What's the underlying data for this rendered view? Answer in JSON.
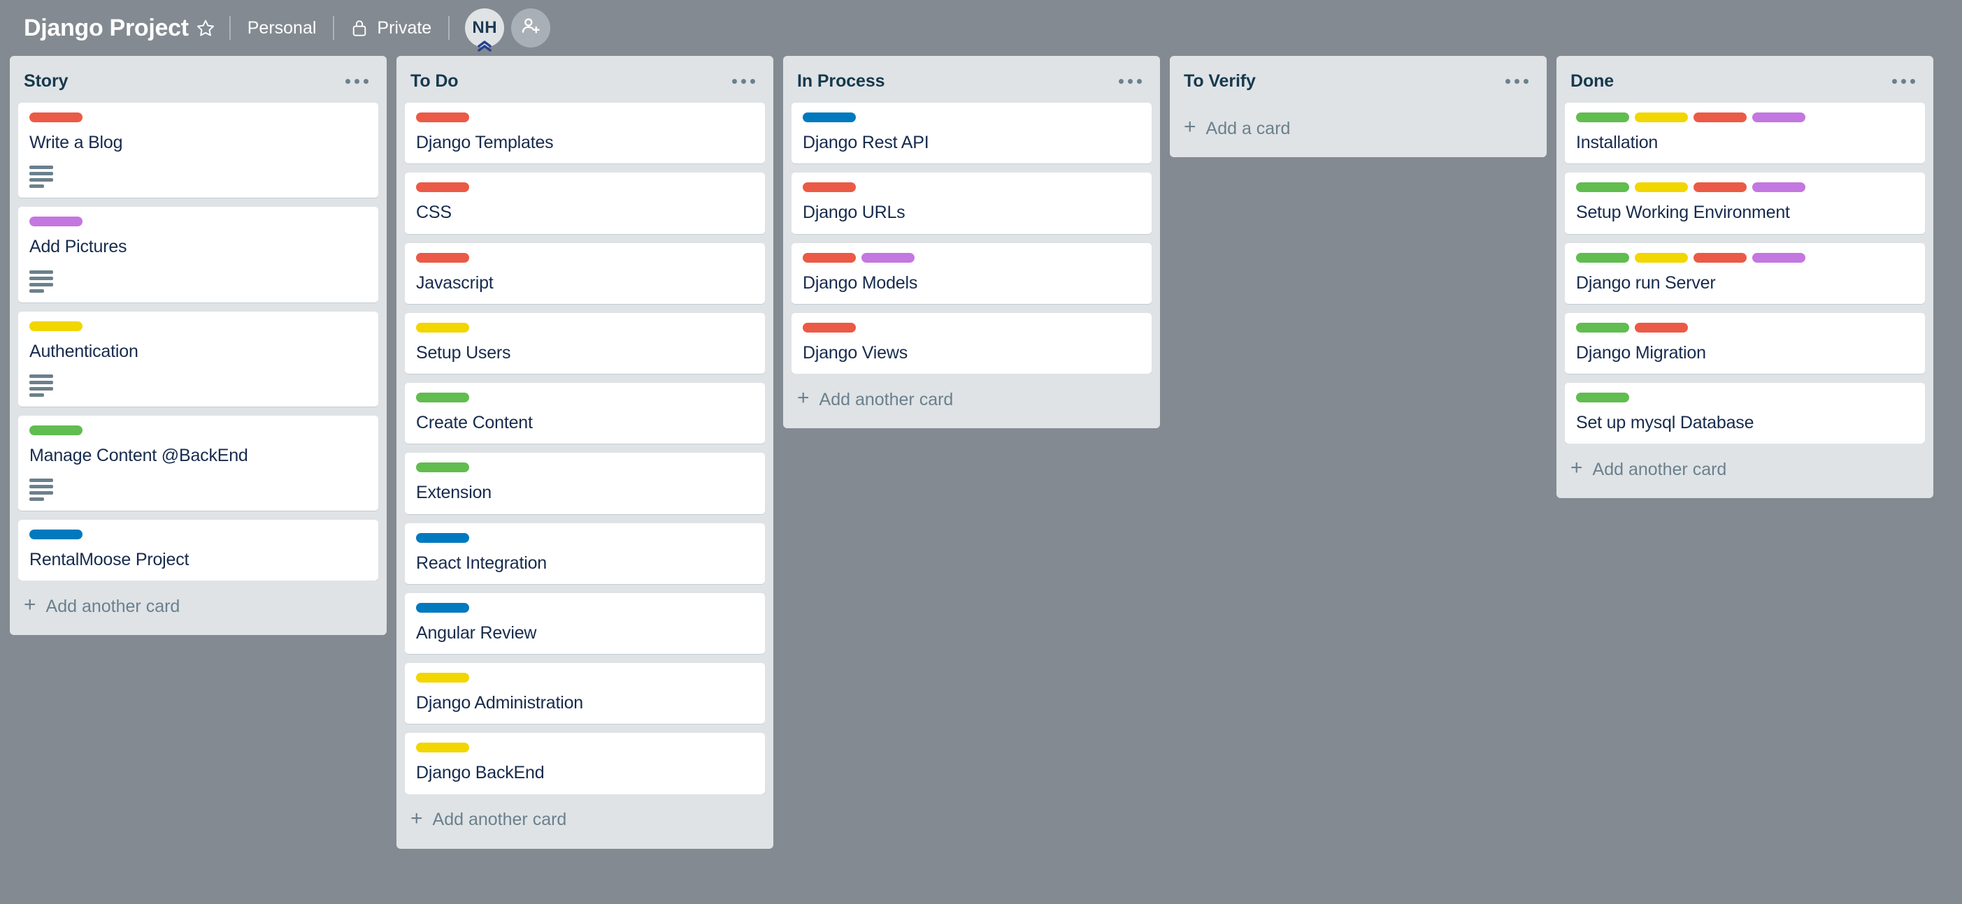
{
  "header": {
    "board_title": "Django Project",
    "star_icon": "star-icon",
    "workspace_label": "Personal",
    "visibility_label": "Private",
    "lock_icon": "lock-icon",
    "member_initials": "NH",
    "add_member_icon": "add-person-icon"
  },
  "label_colors": {
    "green": "#61bd4f",
    "yellow": "#f2d600",
    "red": "#eb5a46",
    "purple": "#c377e0",
    "blue": "#0079bf"
  },
  "lists": [
    {
      "title": "Story",
      "menu_icon": "list-menu-icon",
      "add_card_label": "Add another card",
      "cards": [
        {
          "title": "Write a Blog",
          "labels": [
            "red"
          ],
          "has_description": true
        },
        {
          "title": "Add Pictures",
          "labels": [
            "purple"
          ],
          "has_description": true
        },
        {
          "title": "Authentication",
          "labels": [
            "yellow"
          ],
          "has_description": true
        },
        {
          "title": "Manage Content @BackEnd",
          "labels": [
            "green"
          ],
          "has_description": true
        },
        {
          "title": "RentalMoose Project",
          "labels": [
            "blue"
          ],
          "has_description": false
        }
      ]
    },
    {
      "title": "To Do",
      "menu_icon": "list-menu-icon",
      "add_card_label": "Add another card",
      "cards": [
        {
          "title": "Django Templates",
          "labels": [
            "red"
          ],
          "has_description": false
        },
        {
          "title": "CSS",
          "labels": [
            "red"
          ],
          "has_description": false
        },
        {
          "title": "Javascript",
          "labels": [
            "red"
          ],
          "has_description": false
        },
        {
          "title": "Setup Users",
          "labels": [
            "yellow"
          ],
          "has_description": false
        },
        {
          "title": "Create Content",
          "labels": [
            "green"
          ],
          "has_description": false
        },
        {
          "title": "Extension",
          "labels": [
            "green"
          ],
          "has_description": false
        },
        {
          "title": "React Integration",
          "labels": [
            "blue"
          ],
          "has_description": false
        },
        {
          "title": "Angular Review",
          "labels": [
            "blue"
          ],
          "has_description": false
        },
        {
          "title": "Django Administration",
          "labels": [
            "yellow"
          ],
          "has_description": false
        },
        {
          "title": "Django BackEnd",
          "labels": [
            "yellow"
          ],
          "has_description": false
        }
      ]
    },
    {
      "title": "In Process",
      "menu_icon": "list-menu-icon",
      "add_card_label": "Add another card",
      "cards": [
        {
          "title": "Django Rest API",
          "labels": [
            "blue"
          ],
          "has_description": false
        },
        {
          "title": "Django URLs",
          "labels": [
            "red"
          ],
          "has_description": false
        },
        {
          "title": "Django Models",
          "labels": [
            "red",
            "purple"
          ],
          "has_description": false
        },
        {
          "title": "Django Views",
          "labels": [
            "red"
          ],
          "has_description": false
        }
      ]
    },
    {
      "title": "To Verify",
      "menu_icon": "list-menu-icon",
      "add_card_label": "Add a card",
      "cards": []
    },
    {
      "title": "Done",
      "menu_icon": "list-menu-icon",
      "add_card_label": "Add another card",
      "cards": [
        {
          "title": "Installation",
          "labels": [
            "green",
            "yellow",
            "red",
            "purple"
          ],
          "has_description": false
        },
        {
          "title": "Setup Working Environment",
          "labels": [
            "green",
            "yellow",
            "red",
            "purple"
          ],
          "has_description": false
        },
        {
          "title": "Django run Server",
          "labels": [
            "green",
            "yellow",
            "red",
            "purple"
          ],
          "has_description": false
        },
        {
          "title": "Django Migration",
          "labels": [
            "green",
            "red"
          ],
          "has_description": false
        },
        {
          "title": "Set up mysql Database",
          "labels": [
            "green"
          ],
          "has_description": false
        }
      ]
    }
  ]
}
